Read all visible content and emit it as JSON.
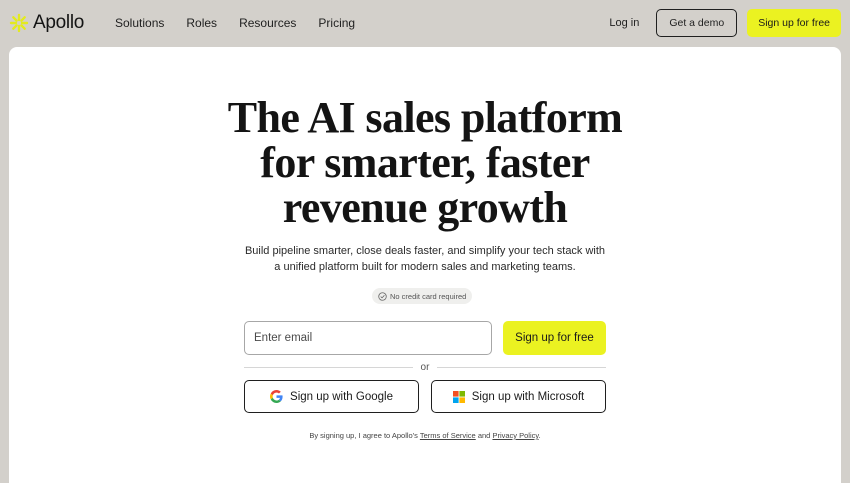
{
  "nav": {
    "brand": "Apollo",
    "links": [
      "Solutions",
      "Roles",
      "Resources",
      "Pricing"
    ],
    "login": "Log in",
    "demo": "Get a demo",
    "signup": "Sign up for free",
    "brand_color": "#ebf221"
  },
  "hero": {
    "headline_lines": [
      "The AI sales platform",
      "for smarter, faster",
      "revenue growth"
    ],
    "subtitle_lines": [
      "Build pipeline smarter, close deals faster, and simplify your tech stack with",
      "a unified platform built for modern sales and marketing teams."
    ],
    "no_card": "No credit card required",
    "email_placeholder": "Enter email",
    "signup": "Sign up for free",
    "or": "or",
    "google": "Sign up with Google",
    "microsoft": "Sign up with Microsoft",
    "legal_prefix": "By signing up, I agree to Apollo's",
    "terms": "Terms of Service",
    "and": "and",
    "privacy": "Privacy Policy",
    "legal_suffix": "."
  }
}
